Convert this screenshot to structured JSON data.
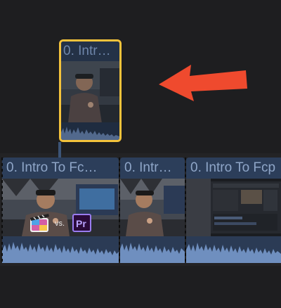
{
  "timeline": {
    "connected_clip": {
      "title": "0. Intr…"
    },
    "clips": [
      {
        "title": "0. Intro To Fc…"
      },
      {
        "title": "0. Intr…"
      },
      {
        "title": "0. Intro To Fcp"
      }
    ],
    "thumbnail_overlay": {
      "vs_text": "vs."
    }
  },
  "colors": {
    "background": "#1e1e20",
    "clip_header": "#2c3e5a",
    "waveform": "#6f8fbf",
    "selection": "#f5c33b",
    "arrow": "#ef4a2e"
  },
  "icons": [
    "fcpx-clapper-icon",
    "premiere-pro-icon",
    "arrow-left-icon"
  ]
}
